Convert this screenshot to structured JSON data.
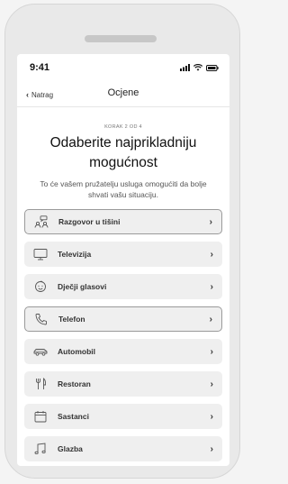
{
  "status": {
    "time": "9:41"
  },
  "nav": {
    "back_label": "Natrag",
    "title": "Ocjene"
  },
  "step_label": "KORAK 2 OD 4",
  "heading_line1": "Odaberite najprikladniju",
  "heading_line2": "mogućnost",
  "subtitle": "To će vašem pružatelju usluga omogućiti da bolje shvati vašu situaciju.",
  "options": [
    {
      "label": "Razgovor u tišini",
      "icon": "people-talking-icon",
      "outlined": true
    },
    {
      "label": "Televizija",
      "icon": "tv-icon",
      "outlined": false
    },
    {
      "label": "Dječji glasovi",
      "icon": "child-face-icon",
      "outlined": false
    },
    {
      "label": "Telefon",
      "icon": "phone-icon",
      "outlined": true
    },
    {
      "label": "Automobil",
      "icon": "car-icon",
      "outlined": false
    },
    {
      "label": "Restoran",
      "icon": "fork-knife-icon",
      "outlined": false
    },
    {
      "label": "Sastanci",
      "icon": "calendar-icon",
      "outlined": false
    },
    {
      "label": "Glazba",
      "icon": "music-note-icon",
      "outlined": false
    }
  ]
}
